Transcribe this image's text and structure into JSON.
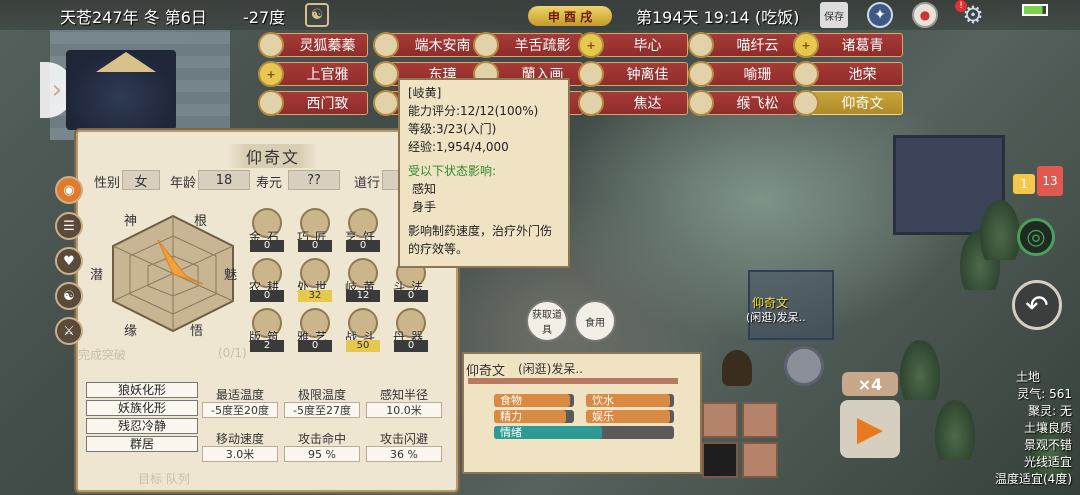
{
  "top": {
    "date": "天苍247年 冬 第6日",
    "temperature": "-27度",
    "season_badge": "申 酉 戌",
    "day_time": "第194天 19:14 (吃饭)",
    "save_label": "保存"
  },
  "roster": [
    {
      "name": "灵狐蓁蓁",
      "plus": false
    },
    {
      "name": "端木安南",
      "plus": false
    },
    {
      "name": "羊舌疏影",
      "plus": false
    },
    {
      "name": "毕心",
      "plus": true
    },
    {
      "name": "喵纤云",
      "plus": false
    },
    {
      "name": "诸葛青",
      "plus": true
    },
    {
      "name": "上官雅",
      "plus": true
    },
    {
      "name": "东璋",
      "plus": false
    },
    {
      "name": "蘭入画",
      "plus": false
    },
    {
      "name": "钟离佳",
      "plus": false
    },
    {
      "name": "喻珊",
      "plus": false
    },
    {
      "name": "池荣",
      "plus": false
    },
    {
      "name": "西门致",
      "plus": false
    },
    {
      "name": "",
      "plus": false
    },
    {
      "name": "",
      "plus": false
    },
    {
      "name": "焦达",
      "plus": false
    },
    {
      "name": "缑飞松",
      "plus": false
    },
    {
      "name": "仰奇文",
      "plus": false,
      "selected": true
    }
  ],
  "character": {
    "name": "仰奇文",
    "gender_label": "性别",
    "gender": "女",
    "age_label": "年龄",
    "age": "18",
    "life_label": "寿元",
    "life": "??",
    "dao_label": "道行",
    "radar_labels": [
      "神",
      "根",
      "魅",
      "悟",
      "缘",
      "潜"
    ],
    "skills": [
      {
        "name": "金石",
        "value": "0"
      },
      {
        "name": "巧匠",
        "value": "0"
      },
      {
        "name": "烹饪",
        "value": "0"
      },
      {
        "name": "农耕",
        "value": "0"
      },
      {
        "name": "处世",
        "value": "32"
      },
      {
        "name": "岐黄",
        "value": "12"
      },
      {
        "name": "斗法",
        "value": "0"
      },
      {
        "name": "版筑",
        "value": "2"
      },
      {
        "name": "雅艺",
        "value": "0"
      },
      {
        "name": "战斗",
        "value": "50"
      },
      {
        "name": "丹器",
        "value": "0"
      }
    ],
    "traits": [
      "狼妖化形",
      "妖族化形",
      "残忍冷静",
      "群居"
    ],
    "stats": [
      {
        "label": "最适温度",
        "value": "-5度至20度"
      },
      {
        "label": "极限温度",
        "value": "-5度至27度"
      },
      {
        "label": "感知半径",
        "value": "10.0米"
      },
      {
        "label": "移动速度",
        "value": "3.0米"
      },
      {
        "label": "攻击命中",
        "value": "95 %"
      },
      {
        "label": "攻击闪避",
        "value": "36 %"
      }
    ],
    "faded_left1": "完成突破",
    "faded_left2": "(0/1)",
    "faded_bottom": "目标  队列"
  },
  "tooltip": {
    "title": "[岐黄]",
    "line1": "能力评分:12/12(100%)",
    "line2": "等级:3/23(入门)",
    "line3": "经验:1,954/4,000",
    "influence_label": "受以下状态影响:",
    "inf1": "感知",
    "inf2": "身手",
    "desc": "影响制药速度，治疗外门伤的疗效等。"
  },
  "bottom": {
    "name": "仰奇文",
    "status": "(闲逛)发呆..",
    "needs": [
      {
        "label": "食物",
        "level": 0.95
      },
      {
        "label": "饮水",
        "level": 0.95
      },
      {
        "label": "精力",
        "level": 0.9
      },
      {
        "label": "娱乐",
        "level": 0.95
      },
      {
        "label": "情绪",
        "level": 0.6
      }
    ]
  },
  "bubbles": {
    "b1": "获取道具",
    "b2": "食用"
  },
  "npc": {
    "label": "仰奇文",
    "status": "(闲逛)发呆.."
  },
  "speed": "×4",
  "badges": {
    "msg": "1",
    "alert": "13"
  },
  "right_info": [
    "土地",
    "灵气: 561",
    "聚灵: 无",
    "土壤良质",
    "景观不错",
    "光线适宜",
    "温度适宜(4度)"
  ],
  "colors": {
    "accent": "#e07b2c",
    "roster_red": "#a63b38",
    "gold": "#e6c84e"
  }
}
